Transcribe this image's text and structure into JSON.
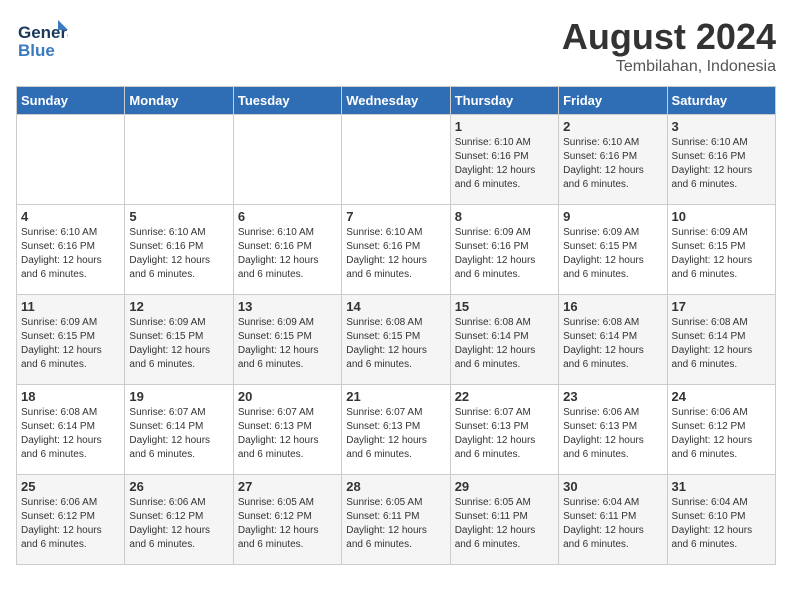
{
  "header": {
    "logo_line1": "General",
    "logo_line2": "Blue",
    "main_title": "August 2024",
    "subtitle": "Tembilahan, Indonesia"
  },
  "days_of_week": [
    "Sunday",
    "Monday",
    "Tuesday",
    "Wednesday",
    "Thursday",
    "Friday",
    "Saturday"
  ],
  "weeks": [
    [
      {
        "day": "",
        "info": ""
      },
      {
        "day": "",
        "info": ""
      },
      {
        "day": "",
        "info": ""
      },
      {
        "day": "",
        "info": ""
      },
      {
        "day": "1",
        "info": "Sunrise: 6:10 AM\nSunset: 6:16 PM\nDaylight: 12 hours\nand 6 minutes."
      },
      {
        "day": "2",
        "info": "Sunrise: 6:10 AM\nSunset: 6:16 PM\nDaylight: 12 hours\nand 6 minutes."
      },
      {
        "day": "3",
        "info": "Sunrise: 6:10 AM\nSunset: 6:16 PM\nDaylight: 12 hours\nand 6 minutes."
      }
    ],
    [
      {
        "day": "4",
        "info": "Sunrise: 6:10 AM\nSunset: 6:16 PM\nDaylight: 12 hours\nand 6 minutes."
      },
      {
        "day": "5",
        "info": "Sunrise: 6:10 AM\nSunset: 6:16 PM\nDaylight: 12 hours\nand 6 minutes."
      },
      {
        "day": "6",
        "info": "Sunrise: 6:10 AM\nSunset: 6:16 PM\nDaylight: 12 hours\nand 6 minutes."
      },
      {
        "day": "7",
        "info": "Sunrise: 6:10 AM\nSunset: 6:16 PM\nDaylight: 12 hours\nand 6 minutes."
      },
      {
        "day": "8",
        "info": "Sunrise: 6:09 AM\nSunset: 6:16 PM\nDaylight: 12 hours\nand 6 minutes."
      },
      {
        "day": "9",
        "info": "Sunrise: 6:09 AM\nSunset: 6:15 PM\nDaylight: 12 hours\nand 6 minutes."
      },
      {
        "day": "10",
        "info": "Sunrise: 6:09 AM\nSunset: 6:15 PM\nDaylight: 12 hours\nand 6 minutes."
      }
    ],
    [
      {
        "day": "11",
        "info": "Sunrise: 6:09 AM\nSunset: 6:15 PM\nDaylight: 12 hours\nand 6 minutes."
      },
      {
        "day": "12",
        "info": "Sunrise: 6:09 AM\nSunset: 6:15 PM\nDaylight: 12 hours\nand 6 minutes."
      },
      {
        "day": "13",
        "info": "Sunrise: 6:09 AM\nSunset: 6:15 PM\nDaylight: 12 hours\nand 6 minutes."
      },
      {
        "day": "14",
        "info": "Sunrise: 6:08 AM\nSunset: 6:15 PM\nDaylight: 12 hours\nand 6 minutes."
      },
      {
        "day": "15",
        "info": "Sunrise: 6:08 AM\nSunset: 6:14 PM\nDaylight: 12 hours\nand 6 minutes."
      },
      {
        "day": "16",
        "info": "Sunrise: 6:08 AM\nSunset: 6:14 PM\nDaylight: 12 hours\nand 6 minutes."
      },
      {
        "day": "17",
        "info": "Sunrise: 6:08 AM\nSunset: 6:14 PM\nDaylight: 12 hours\nand 6 minutes."
      }
    ],
    [
      {
        "day": "18",
        "info": "Sunrise: 6:08 AM\nSunset: 6:14 PM\nDaylight: 12 hours\nand 6 minutes."
      },
      {
        "day": "19",
        "info": "Sunrise: 6:07 AM\nSunset: 6:14 PM\nDaylight: 12 hours\nand 6 minutes."
      },
      {
        "day": "20",
        "info": "Sunrise: 6:07 AM\nSunset: 6:13 PM\nDaylight: 12 hours\nand 6 minutes."
      },
      {
        "day": "21",
        "info": "Sunrise: 6:07 AM\nSunset: 6:13 PM\nDaylight: 12 hours\nand 6 minutes."
      },
      {
        "day": "22",
        "info": "Sunrise: 6:07 AM\nSunset: 6:13 PM\nDaylight: 12 hours\nand 6 minutes."
      },
      {
        "day": "23",
        "info": "Sunrise: 6:06 AM\nSunset: 6:13 PM\nDaylight: 12 hours\nand 6 minutes."
      },
      {
        "day": "24",
        "info": "Sunrise: 6:06 AM\nSunset: 6:12 PM\nDaylight: 12 hours\nand 6 minutes."
      }
    ],
    [
      {
        "day": "25",
        "info": "Sunrise: 6:06 AM\nSunset: 6:12 PM\nDaylight: 12 hours\nand 6 minutes."
      },
      {
        "day": "26",
        "info": "Sunrise: 6:06 AM\nSunset: 6:12 PM\nDaylight: 12 hours\nand 6 minutes."
      },
      {
        "day": "27",
        "info": "Sunrise: 6:05 AM\nSunset: 6:12 PM\nDaylight: 12 hours\nand 6 minutes."
      },
      {
        "day": "28",
        "info": "Sunrise: 6:05 AM\nSunset: 6:11 PM\nDaylight: 12 hours\nand 6 minutes."
      },
      {
        "day": "29",
        "info": "Sunrise: 6:05 AM\nSunset: 6:11 PM\nDaylight: 12 hours\nand 6 minutes."
      },
      {
        "day": "30",
        "info": "Sunrise: 6:04 AM\nSunset: 6:11 PM\nDaylight: 12 hours\nand 6 minutes."
      },
      {
        "day": "31",
        "info": "Sunrise: 6:04 AM\nSunset: 6:10 PM\nDaylight: 12 hours\nand 6 minutes."
      }
    ]
  ]
}
